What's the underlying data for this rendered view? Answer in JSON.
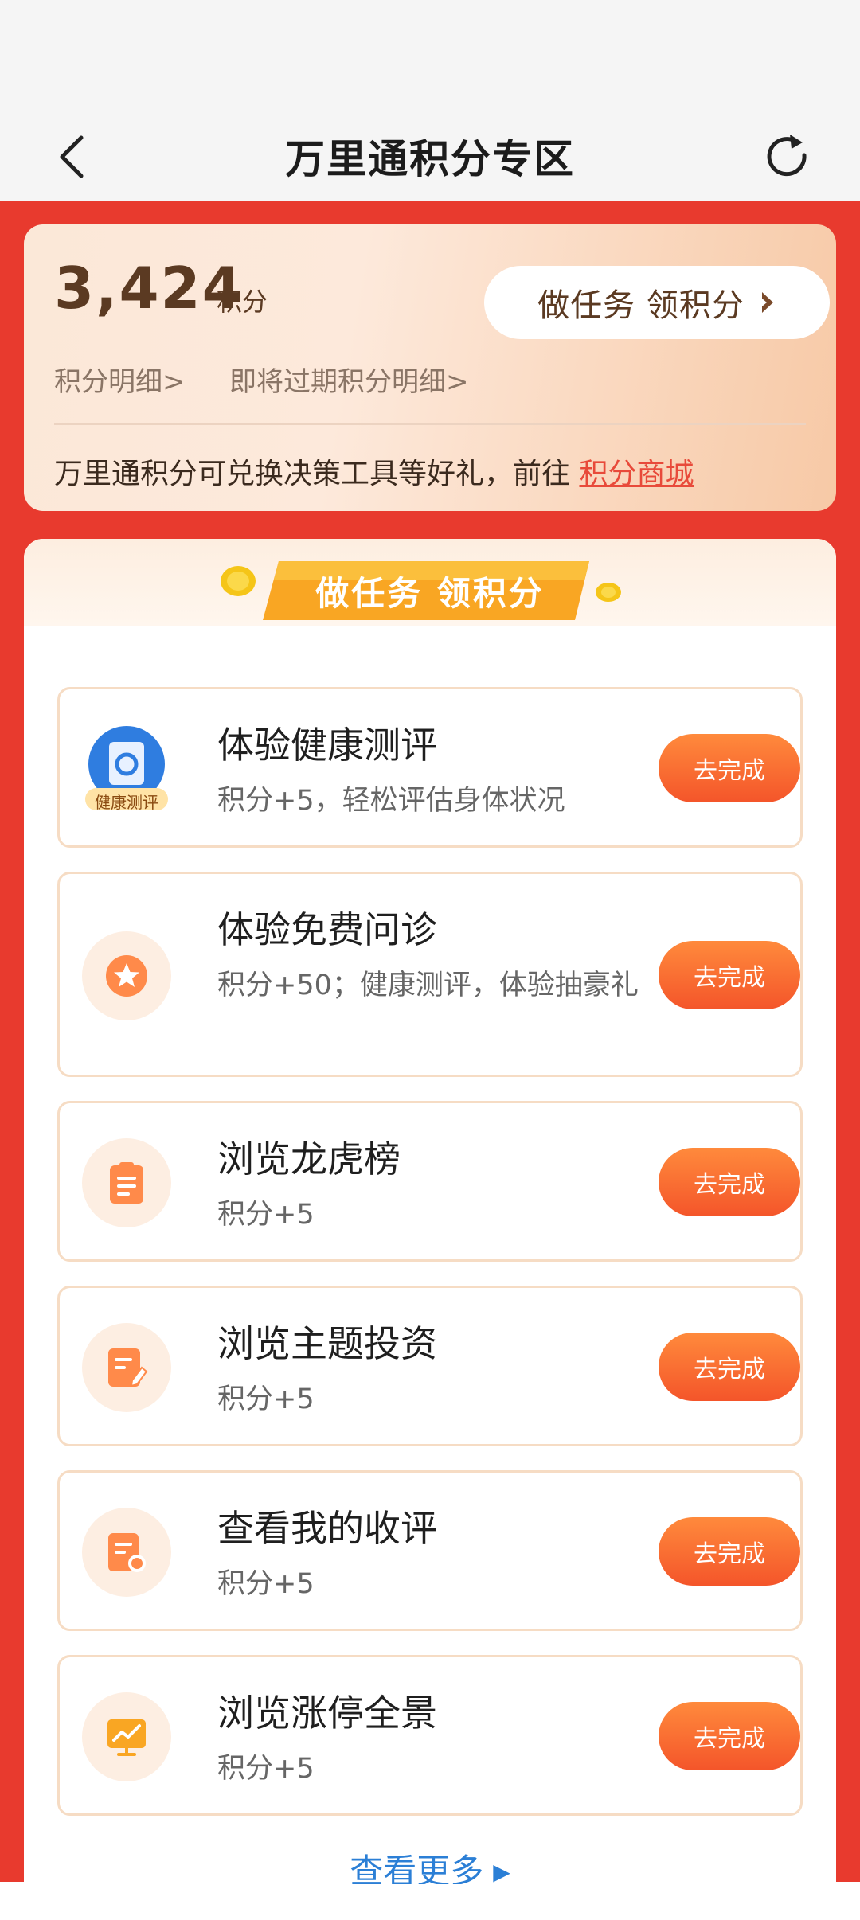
{
  "header": {
    "title": "万里通积分专区",
    "back_icon": "chevron-left-icon",
    "refresh_icon": "refresh-icon"
  },
  "points_card": {
    "points": "3,424",
    "unit": "积分",
    "task_button": "做任务 领积分",
    "detail_link": "积分明细>",
    "expiring_link": "即将过期积分明细>",
    "exchange_text": "万里通积分可兑换决策工具等好礼，前往",
    "mall_link": "积分商城"
  },
  "task_panel": {
    "banner": "做任务 领积分",
    "tasks": [
      {
        "title": "体验健康测评",
        "desc": "积分+5，轻松评估身体状况",
        "button": "去完成",
        "icon": "health-test-icon",
        "icon_badge": "健康测评"
      },
      {
        "title": "体验免费问诊",
        "desc": "积分+50；健康测评，体验抽豪礼",
        "button": "去完成",
        "icon": "star-icon"
      },
      {
        "title": "浏览龙虎榜",
        "desc": "积分+5",
        "button": "去完成",
        "icon": "clipboard-icon"
      },
      {
        "title": "浏览主题投资",
        "desc": "积分+5",
        "button": "去完成",
        "icon": "edit-doc-icon"
      },
      {
        "title": "查看我的收评",
        "desc": "积分+5",
        "button": "去完成",
        "icon": "review-doc-icon"
      },
      {
        "title": "浏览涨停全景",
        "desc": "积分+5",
        "button": "去完成",
        "icon": "chart-board-icon"
      }
    ],
    "more_link": "查看更多"
  },
  "colors": {
    "brand_red": "#e83a2e",
    "button_orange": "#f4552a",
    "link_blue": "#2b7fd6"
  }
}
